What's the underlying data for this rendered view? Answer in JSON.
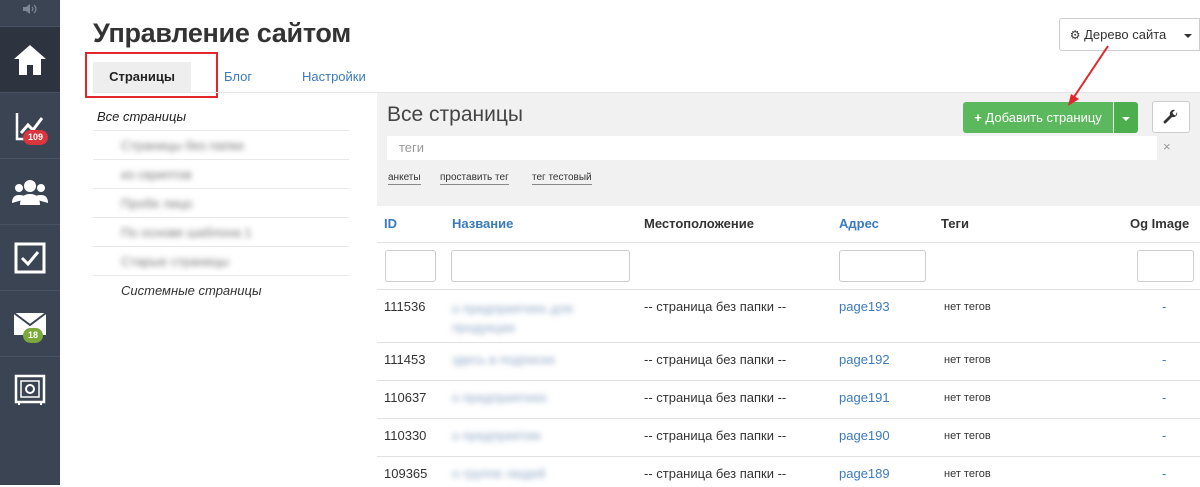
{
  "sidebar": {
    "badges": {
      "stats": "109",
      "mail": "18"
    }
  },
  "header": {
    "title": "Управление сайтом",
    "site_tree_label": "Дерево сайта"
  },
  "tabs": [
    "Страницы",
    "Блог",
    "Настройки"
  ],
  "left_list": {
    "all_pages": "Все страницы",
    "items": [
      "Страницы без папки",
      "из скриптов",
      "Пробе лицо",
      "По основе шаблона 1",
      "Старые страницы"
    ],
    "system_pages": "Системные страницы"
  },
  "panel": {
    "title": "Все страницы",
    "add_page_label": "Добавить страницу",
    "tags_placeholder": "теги",
    "clear": "×",
    "tag_chips": [
      "анкеты",
      "проставить тег",
      "тег тестовый"
    ]
  },
  "table": {
    "columns": {
      "id": "ID",
      "name": "Название",
      "location": "Местоположение",
      "address": "Адрес",
      "tags": "Теги",
      "og": "Og Image"
    },
    "rows": [
      {
        "id": "111536",
        "name": "о предприятиях для продукции",
        "location": "-- страница без папки --",
        "address": "page193",
        "tags": "нет тегов",
        "og": "-"
      },
      {
        "id": "111453",
        "name": "здесь в подписке",
        "location": "-- страница без папки --",
        "address": "page192",
        "tags": "нет тегов",
        "og": "-"
      },
      {
        "id": "110637",
        "name": "о предприятиях",
        "location": "-- страница без папки --",
        "address": "page191",
        "tags": "нет тегов",
        "og": "-"
      },
      {
        "id": "110330",
        "name": "о предприятии",
        "location": "-- страница без папки --",
        "address": "page190",
        "tags": "нет тегов",
        "og": "-"
      },
      {
        "id": "109365",
        "name": "о группе людей",
        "location": "-- страница без папки --",
        "address": "page189",
        "tags": "нет тегов",
        "og": "-"
      }
    ]
  },
  "colors": {
    "sidebar": "#3b4452",
    "accent_green": "#5cb85c",
    "link": "#3a7abf",
    "highlight_red": "#e1262b",
    "badge_red": "#d9363e",
    "badge_green": "#7aa83a"
  },
  "icons": [
    "speaker-icon",
    "home-icon",
    "chart-icon",
    "users-icon",
    "checkbox-icon",
    "mail-icon",
    "safe-icon",
    "gear-icon",
    "plus-icon",
    "wrench-icon",
    "caret-down-icon"
  ]
}
